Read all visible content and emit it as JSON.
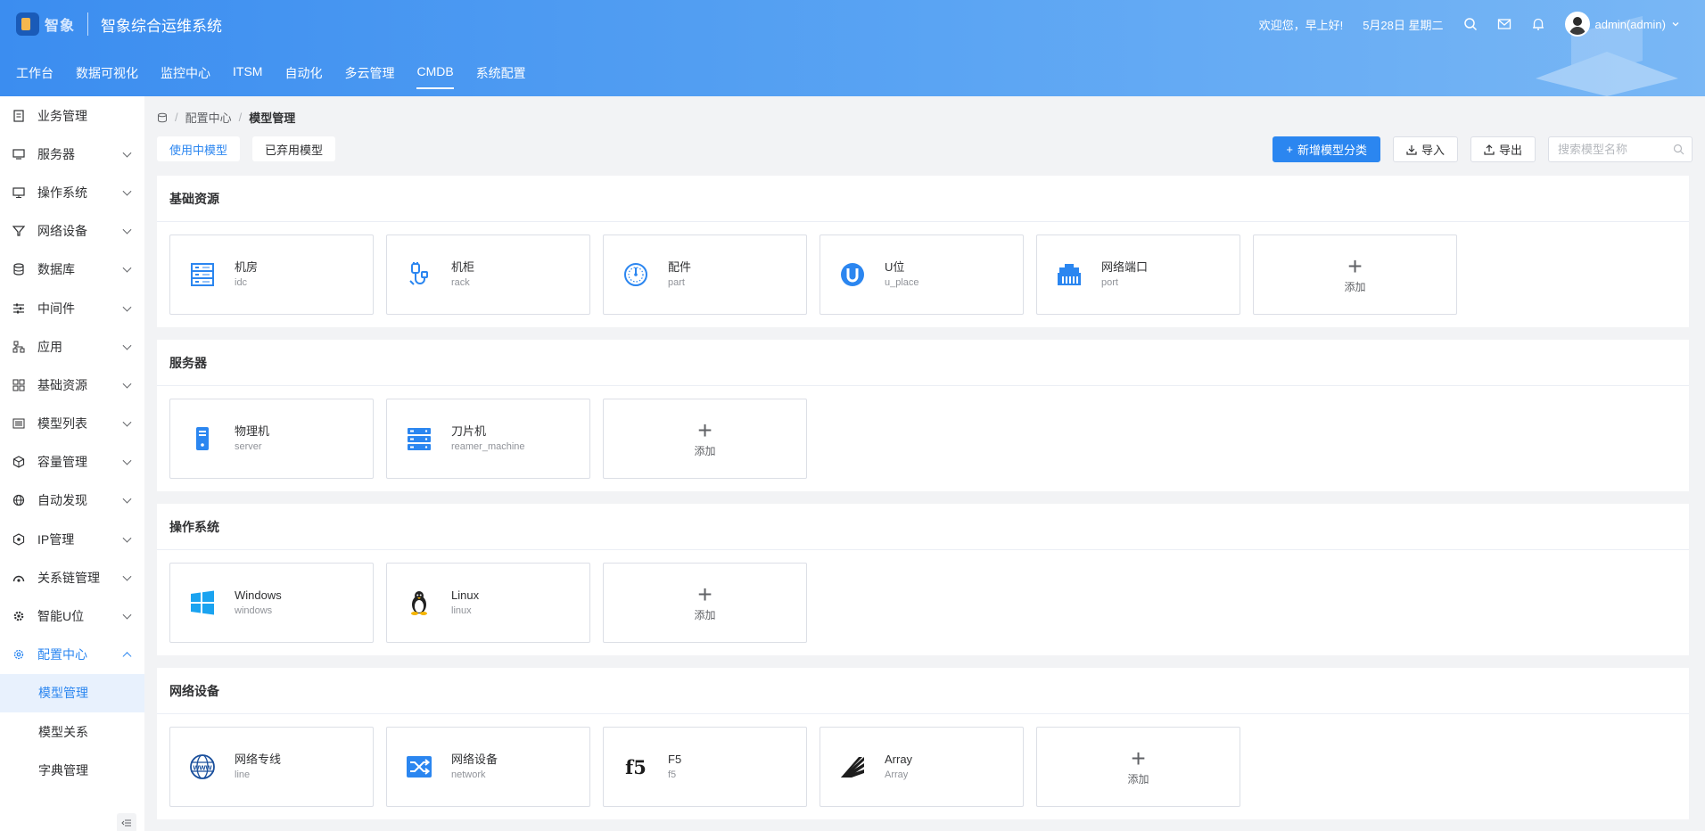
{
  "header": {
    "logo_text": "智象",
    "app_title": "智象综合运维系统",
    "greeting": "欢迎您，早上好!",
    "date": "5月28日 星期二",
    "user": "admin(admin)"
  },
  "topnav": [
    "工作台",
    "数据可视化",
    "监控中心",
    "ITSM",
    "自动化",
    "多云管理",
    "CMDB",
    "系统配置"
  ],
  "sidebar": {
    "items": [
      "业务管理",
      "服务器",
      "操作系统",
      "网络设备",
      "数据库",
      "中间件",
      "应用",
      "基础资源",
      "模型列表",
      "容量管理",
      "自动发现",
      "IP管理",
      "关系链管理",
      "智能U位",
      "配置中心"
    ],
    "sub_items": [
      "模型管理",
      "模型关系",
      "字典管理"
    ]
  },
  "breadcrumb": [
    "配置中心",
    "模型管理"
  ],
  "tabs": [
    "使用中模型",
    "已弃用模型"
  ],
  "toolbar": {
    "add_category": "新增模型分类",
    "import": "导入",
    "export": "导出",
    "search_placeholder": "搜索模型名称"
  },
  "add_label": "添加",
  "sections": [
    {
      "title": "基础资源",
      "cards": [
        {
          "name": "机房",
          "code": "idc",
          "icon": "server-rack-icon"
        },
        {
          "name": "机柜",
          "code": "rack",
          "icon": "cable-plug-icon"
        },
        {
          "name": "配件",
          "code": "part",
          "icon": "gauge-icon"
        },
        {
          "name": "U位",
          "code": "u_place",
          "icon": "u-badge-icon"
        },
        {
          "name": "网络端口",
          "code": "port",
          "icon": "ethernet-port-icon"
        }
      ]
    },
    {
      "title": "服务器",
      "cards": [
        {
          "name": "物理机",
          "code": "server",
          "icon": "tower-server-icon"
        },
        {
          "name": "刀片机",
          "code": "reamer_machine",
          "icon": "blade-server-icon"
        }
      ]
    },
    {
      "title": "操作系统",
      "cards": [
        {
          "name": "Windows",
          "code": "windows",
          "icon": "windows-logo-icon"
        },
        {
          "name": "Linux",
          "code": "linux",
          "icon": "linux-penguin-icon"
        }
      ]
    },
    {
      "title": "网络设备",
      "cards": [
        {
          "name": "网络专线",
          "code": "line",
          "icon": "www-globe-icon"
        },
        {
          "name": "网络设备",
          "code": "network",
          "icon": "network-switch-icon"
        },
        {
          "name": "F5",
          "code": "f5",
          "icon": "f5-logo-icon"
        },
        {
          "name": "Array",
          "code": "Array",
          "icon": "array-logo-icon"
        }
      ]
    }
  ],
  "colors": {
    "accent": "#2b86f0",
    "header_start": "#3b8df0",
    "header_end": "#79b7f5"
  }
}
